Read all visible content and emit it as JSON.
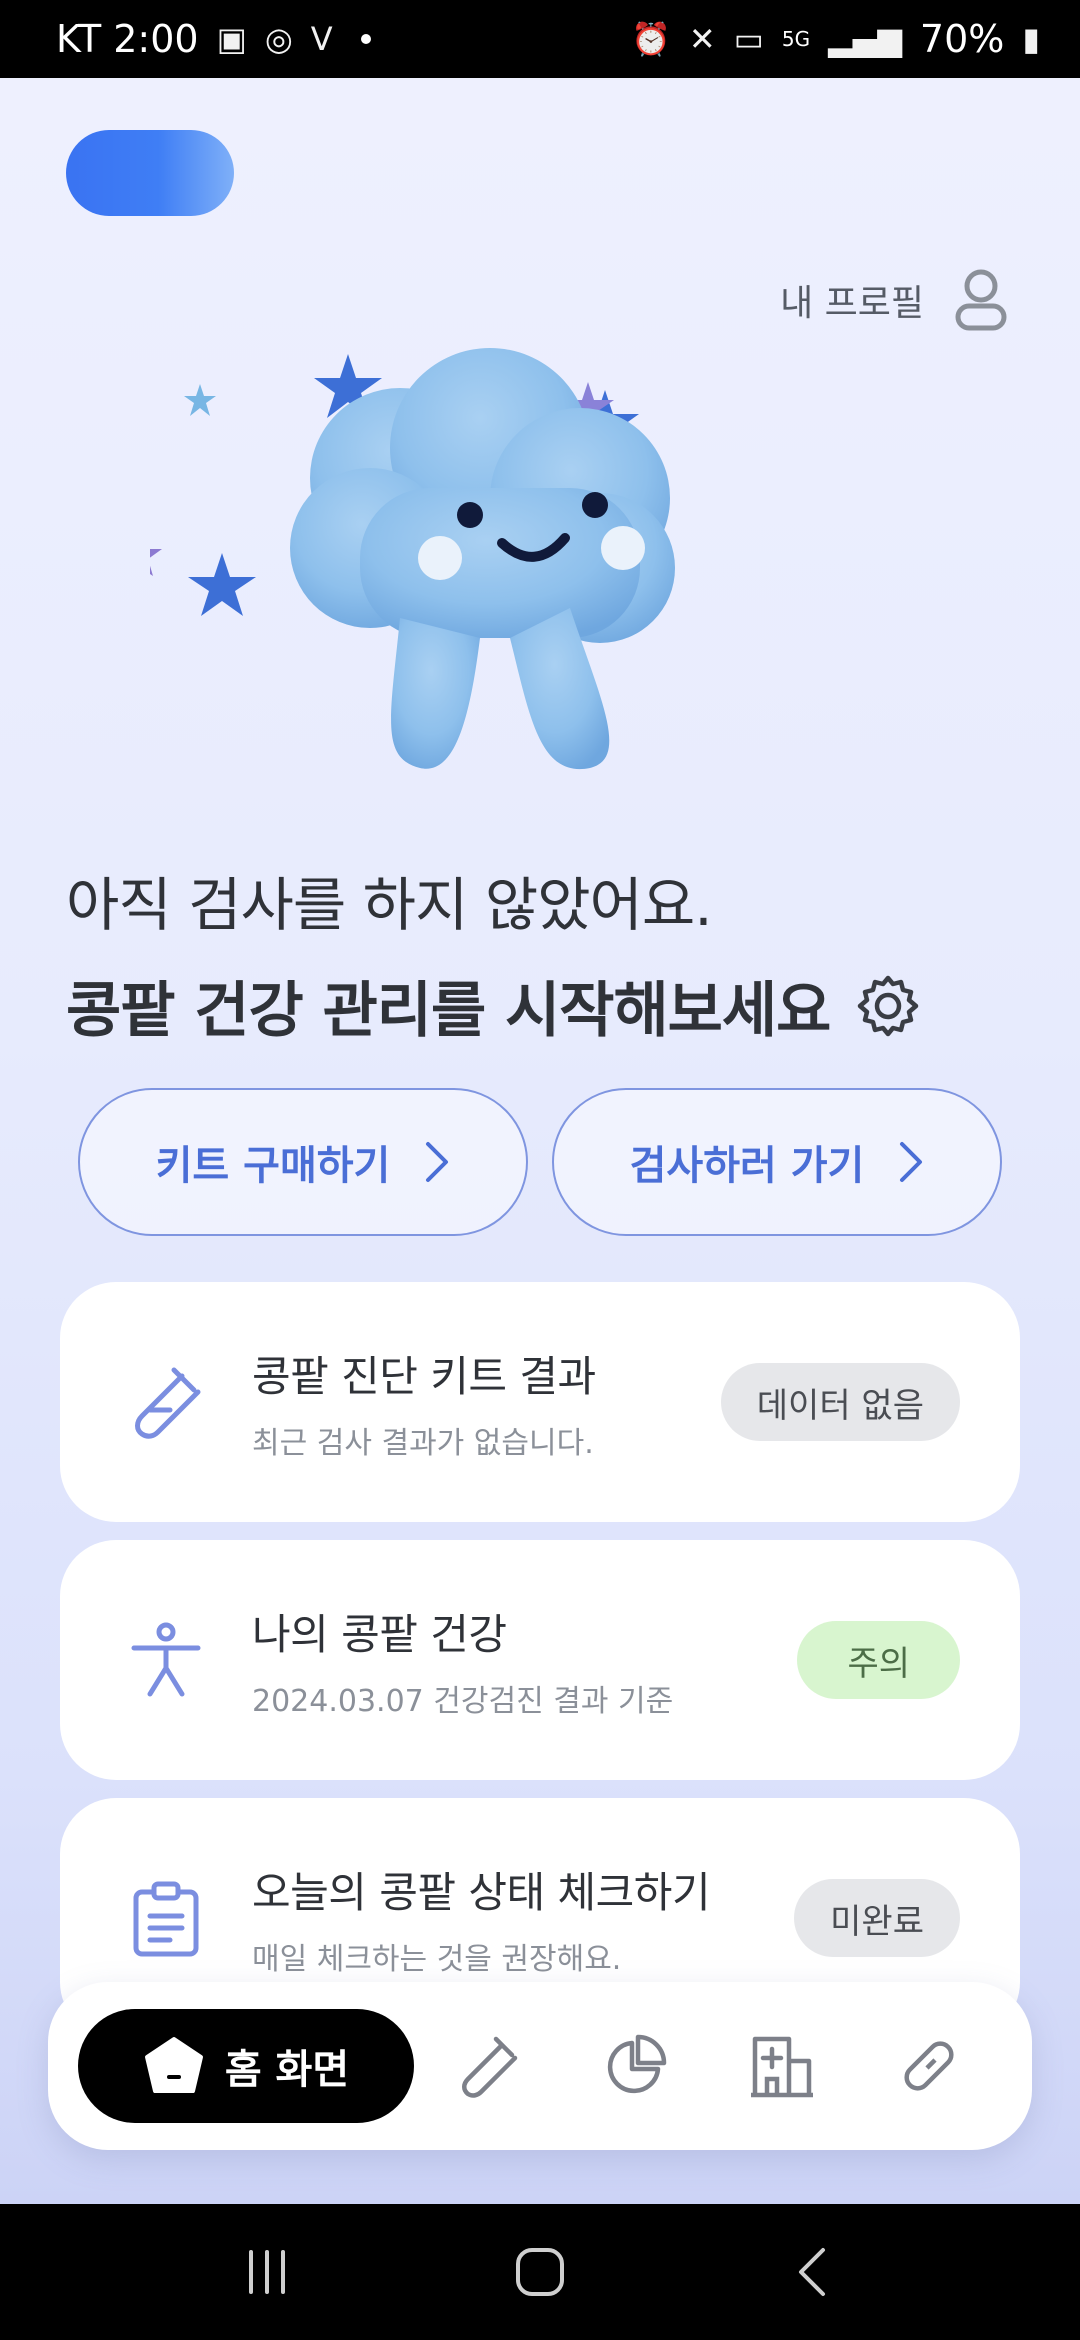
{
  "status_bar": {
    "carrier_time": "KT 2:00",
    "battery": "70%",
    "network": "5G"
  },
  "header": {
    "profile_label": "내 프로필"
  },
  "headline": {
    "line1": "아직 검사를 하지 않았어요.",
    "line2": "콩팥 건강 관리를 시작해보세요"
  },
  "cta": {
    "buy_kit": "키트 구매하기",
    "go_test": "검사하러 가기"
  },
  "cards": [
    {
      "title": "콩팥 진단 키트 결과",
      "subtitle": "최근 검사 결과가 없습니다.",
      "badge": "데이터 없음",
      "icon": "test-tube-icon"
    },
    {
      "title": "나의 콩팥 건강",
      "subtitle": "2024.03.07 건강검진 결과 기준",
      "badge": "주의",
      "icon": "person-icon"
    },
    {
      "title": "오늘의 콩팥 상태 체크하기",
      "subtitle": "매일 체크하는 것을 권장해요.",
      "badge": "미완료",
      "icon": "clipboard-icon"
    }
  ],
  "bottom_nav": {
    "home_label": "홈 화면",
    "items": [
      "test-tube-icon",
      "pie-chart-icon",
      "hospital-icon",
      "pill-icon"
    ]
  },
  "colors": {
    "accent_blue": "#4a6ed6",
    "logo_blue": "#3a73f2",
    "badge_green_bg": "#d8f5cf"
  }
}
